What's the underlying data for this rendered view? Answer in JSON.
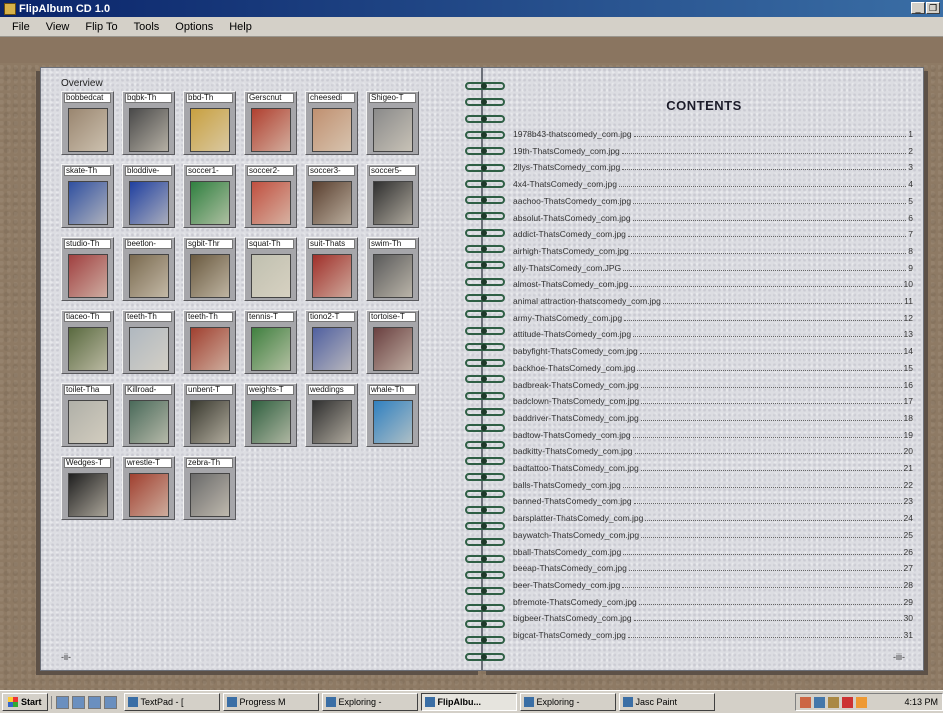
{
  "window": {
    "title": "FlipAlbum CD 1.0"
  },
  "menu": [
    "File",
    "View",
    "Flip To",
    "Tools",
    "Options",
    "Help"
  ],
  "left_page": {
    "overview_label": "Overview",
    "page_number": "-ii-",
    "thumbnails": [
      {
        "label": "bobbedcat",
        "color": "#9a8670"
      },
      {
        "label": "bqbk-Th",
        "color": "#4a4a4a"
      },
      {
        "label": "bbd-Th",
        "color": "#c8a040"
      },
      {
        "label": "Gerscnut",
        "color": "#b04030"
      },
      {
        "label": "cheesedi",
        "color": "#c09070"
      },
      {
        "label": "Shigeo-T",
        "color": "#8a8a8a"
      },
      {
        "label": "skate-Th",
        "color": "#3050a0"
      },
      {
        "label": "bloddive-",
        "color": "#2040a0"
      },
      {
        "label": "soccer1-",
        "color": "#308040"
      },
      {
        "label": "soccer2-",
        "color": "#c05040"
      },
      {
        "label": "soccer3-",
        "color": "#5a4030"
      },
      {
        "label": "soccer5-",
        "color": "#303030"
      },
      {
        "label": "studio-Th",
        "color": "#a04040"
      },
      {
        "label": "beetlon-",
        "color": "#7a6a50"
      },
      {
        "label": "sgbit-Thr",
        "color": "#6a5a40"
      },
      {
        "label": "squat-Th",
        "color": "#c0c0b0"
      },
      {
        "label": "suit-Thats",
        "color": "#a0302a"
      },
      {
        "label": "swim-Th",
        "color": "#5a5a5a"
      },
      {
        "label": "tiaceo-Th",
        "color": "#5a6a40"
      },
      {
        "label": "teeth-Th",
        "color": "#b0b8c0"
      },
      {
        "label": "teeth-Th",
        "color": "#a04030"
      },
      {
        "label": "tennis-T",
        "color": "#408040"
      },
      {
        "label": "tiono2-T",
        "color": "#5060a0"
      },
      {
        "label": "tortoise-T",
        "color": "#6a4040"
      },
      {
        "label": "toilet-Tha",
        "color": "#b0b0a8"
      },
      {
        "label": "Killroad-",
        "color": "#4a6a5a"
      },
      {
        "label": "unbent-T",
        "color": "#3a3a30"
      },
      {
        "label": "weights-T",
        "color": "#306040"
      },
      {
        "label": "weddings",
        "color": "#303030"
      },
      {
        "label": "whale-Th",
        "color": "#3080c0"
      },
      {
        "label": "Wedges-T",
        "color": "#202020"
      },
      {
        "label": "wrestle-T",
        "color": "#a04030"
      },
      {
        "label": "zebra-Th",
        "color": "#6a6a6a"
      }
    ]
  },
  "right_page": {
    "title": "CONTENTS",
    "page_number": "-iii-",
    "entries": [
      {
        "name": "1978b43-thatscomedy_com.jpg",
        "page": "1"
      },
      {
        "name": "19th-ThatsComedy_com.jpg",
        "page": "2"
      },
      {
        "name": "2llys-ThatsComedy_com.jpg",
        "page": "3"
      },
      {
        "name": "4x4-ThatsComedy_com.jpg",
        "page": "4"
      },
      {
        "name": "aachoo-ThatsComedy_com.jpg",
        "page": "5"
      },
      {
        "name": "absolut-ThatsComedy_com.jpg",
        "page": "6"
      },
      {
        "name": "addict-ThatsComedy_com.jpg",
        "page": "7"
      },
      {
        "name": "airhigh-ThatsComedy_com.jpg",
        "page": "8"
      },
      {
        "name": "ally-ThatsComedy_com.JPG",
        "page": "9"
      },
      {
        "name": "almost-ThatsComedy_com.jpg",
        "page": "10"
      },
      {
        "name": "animal attraction-thatscomedy_com.jpg",
        "page": "11"
      },
      {
        "name": "army-ThatsComedy_com.jpg",
        "page": "12"
      },
      {
        "name": "attitude-ThatsComedy_com.jpg",
        "page": "13"
      },
      {
        "name": "babyfight-ThatsComedy_com.jpg",
        "page": "14"
      },
      {
        "name": "backhoe-ThatsComedy_com.jpg",
        "page": "15"
      },
      {
        "name": "badbreak-ThatsComedy_com.jpg",
        "page": "16"
      },
      {
        "name": "badclown-ThatsComedy_com.jpg",
        "page": "17"
      },
      {
        "name": "baddriver-ThatsComedy_com.jpg",
        "page": "18"
      },
      {
        "name": "badtow-ThatsComedy_com.jpg",
        "page": "19"
      },
      {
        "name": "badkitty-ThatsComedy_com.jpg",
        "page": "20"
      },
      {
        "name": "badtattoo-ThatsComedy_com.jpg",
        "page": "21"
      },
      {
        "name": "balls-ThatsComedy_com.jpg",
        "page": "22"
      },
      {
        "name": "banned-ThatsComedy_com.jpg",
        "page": "23"
      },
      {
        "name": "barsplatter-ThatsComedy_com.jpg",
        "page": "24"
      },
      {
        "name": "baywatch-ThatsComedy_com.jpg",
        "page": "25"
      },
      {
        "name": "bball-ThatsComedy_com.jpg",
        "page": "26"
      },
      {
        "name": "beeap-ThatsComedy_com.jpg",
        "page": "27"
      },
      {
        "name": "beer-ThatsComedy_com.jpg",
        "page": "28"
      },
      {
        "name": "bfremote-ThatsComedy_com.jpg",
        "page": "29"
      },
      {
        "name": "bigbeer-ThatsComedy_com.jpg",
        "page": "30"
      },
      {
        "name": "bigcat-ThatsComedy_com.jpg",
        "page": "31"
      }
    ]
  },
  "taskbar": {
    "start": "Start",
    "tasks": [
      "TextPad - [",
      "Progress M",
      "Exploring -",
      "FlipAlbu...",
      "Exploring -",
      "Jasc Paint"
    ],
    "active_index": 3,
    "clock": "4:13 PM"
  }
}
